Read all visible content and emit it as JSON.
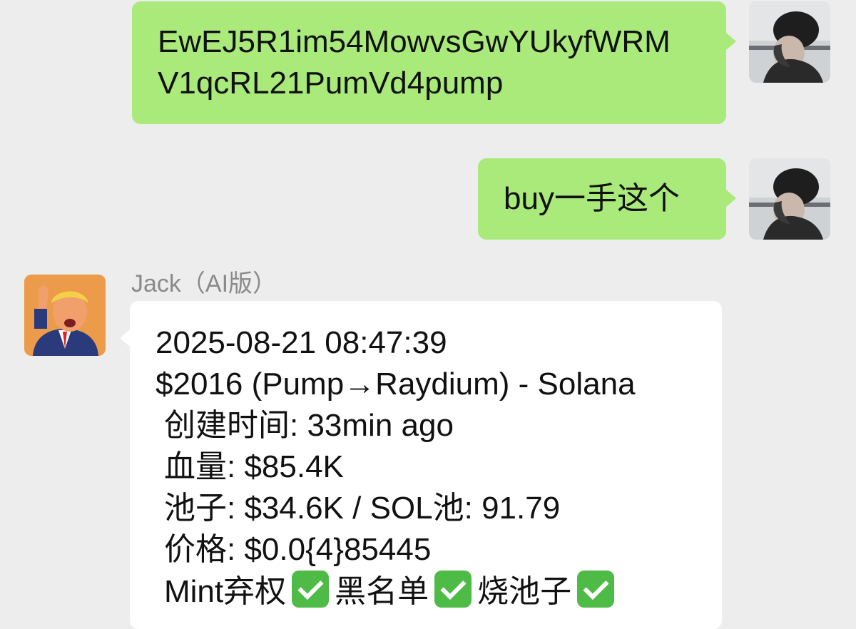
{
  "messages": [
    {
      "direction": "outgoing",
      "lines": [
        "EwEJ5R1im54MowvsGwYUkyfWRM",
        "V1qcRL21PumVd4pump"
      ]
    },
    {
      "direction": "outgoing",
      "text": "buy一手这个"
    },
    {
      "direction": "incoming",
      "sender": "Jack（AI版）",
      "lines": [
        "2025-08-21 08:47:39",
        "$2016 (Pump→Raydium) - Solana",
        "创建时间: 33min ago",
        "血量: $85.4K",
        "池子: $34.6K / SOL池: 91.79",
        "价格: $0.0{4}85445"
      ],
      "flags": [
        "Mint弃权",
        "黑名单",
        "烧池子"
      ]
    }
  ],
  "colors": {
    "background": "#ededed",
    "outgoing_bubble": "#a9ea7a",
    "incoming_bubble": "#ffffff",
    "check_badge": "#4fbb47"
  },
  "icons": {
    "check": "white-check-mark-emoji"
  }
}
